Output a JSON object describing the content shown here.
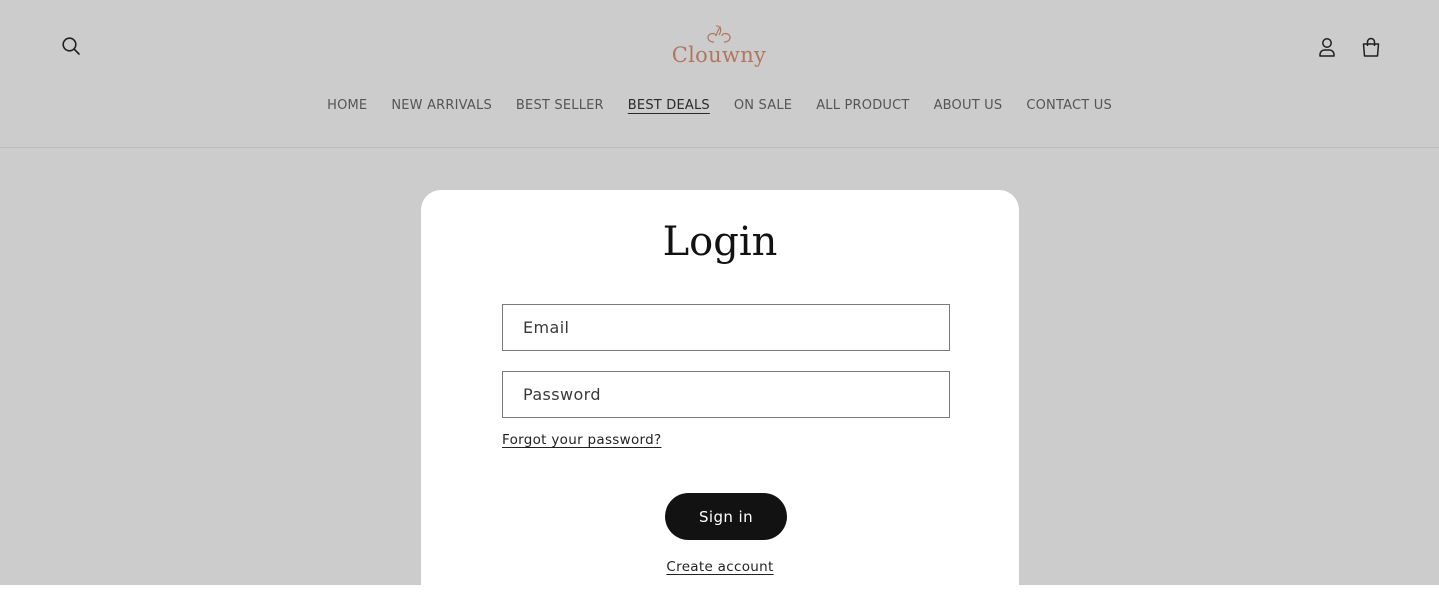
{
  "brand": {
    "name": "Clouwny",
    "color": "#b0765f"
  },
  "header": {
    "search_icon": "search-icon",
    "account_icon": "user-icon",
    "cart_icon": "shopping-bag-icon"
  },
  "nav": {
    "items": [
      {
        "label": "HOME",
        "active": false
      },
      {
        "label": "NEW ARRIVALS",
        "active": false
      },
      {
        "label": "BEST SELLER",
        "active": false
      },
      {
        "label": "BEST DEALS",
        "active": true
      },
      {
        "label": "ON SALE",
        "active": false
      },
      {
        "label": "ALL PRODUCT",
        "active": false
      },
      {
        "label": "ABOUT US",
        "active": false
      },
      {
        "label": "CONTACT US",
        "active": false
      }
    ]
  },
  "login": {
    "title": "Login",
    "email_placeholder": "Email",
    "email_value": "",
    "password_placeholder": "Password",
    "password_value": "",
    "forgot_label": "Forgot your password?",
    "signin_label": "Sign in",
    "create_account_label": "Create account"
  },
  "colors": {
    "background": "#cccccc",
    "card": "#ffffff",
    "button": "#121212"
  }
}
